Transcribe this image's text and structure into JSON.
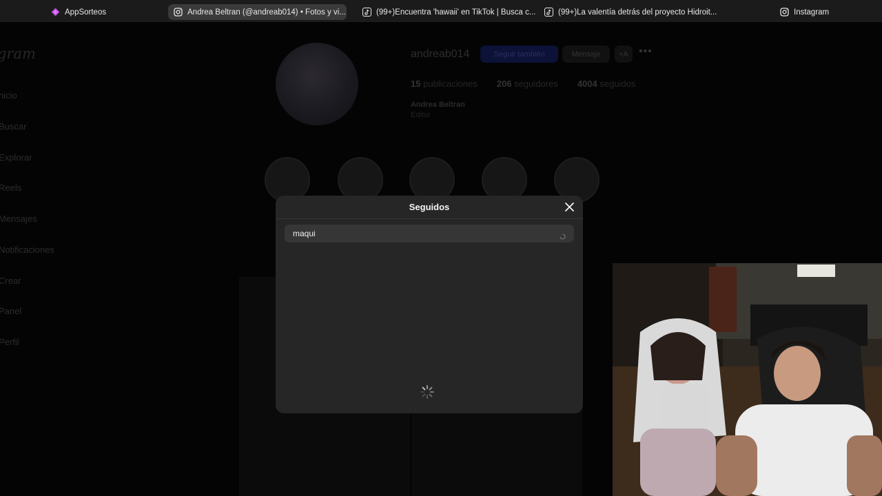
{
  "browser": {
    "tabs": [
      {
        "label": "AppSorteos",
        "icon": "appsorteos-icon",
        "active": false
      },
      {
        "label": "Andrea Beltran (@andreab014) • Fotos y vi...",
        "icon": "instagram-icon",
        "active": true
      },
      {
        "label": "(99+)Encuentra 'hawaii' en TikTok | Busca c...",
        "icon": "tiktok-icon",
        "active": false
      },
      {
        "label": "(99+)La valentía detrás del proyecto Hidroit...",
        "icon": "tiktok-icon",
        "active": false
      },
      {
        "label": "Instagram",
        "icon": "instagram-icon",
        "active": false
      }
    ]
  },
  "sidebar": {
    "brand": "gram",
    "items": [
      {
        "label": "nicio"
      },
      {
        "label": "Buscar"
      },
      {
        "label": "Explorar"
      },
      {
        "label": "Reels"
      },
      {
        "label": "Mensajes"
      },
      {
        "label": "Notificaciones"
      },
      {
        "label": "Crear"
      },
      {
        "label": "Panel"
      },
      {
        "label": "Perfil"
      }
    ]
  },
  "profile": {
    "username": "andreab014",
    "follow_back_label": "Seguir también",
    "message_label": "Mensaje",
    "add_label": "+A",
    "more_label": "•••",
    "posts_count": "15",
    "posts_label": "publicaciones",
    "followers_count": "206",
    "followers_label": "seguidores",
    "following_count": "4004",
    "following_label": "seguidos",
    "full_name": "Andrea Beltran",
    "bio": "Editor"
  },
  "modal": {
    "title": "Seguidos",
    "search_value": "maqui",
    "loading": true
  },
  "colors": {
    "modal_bg": "#262626",
    "search_bg": "#363636",
    "follow_button": "#0c1238"
  }
}
